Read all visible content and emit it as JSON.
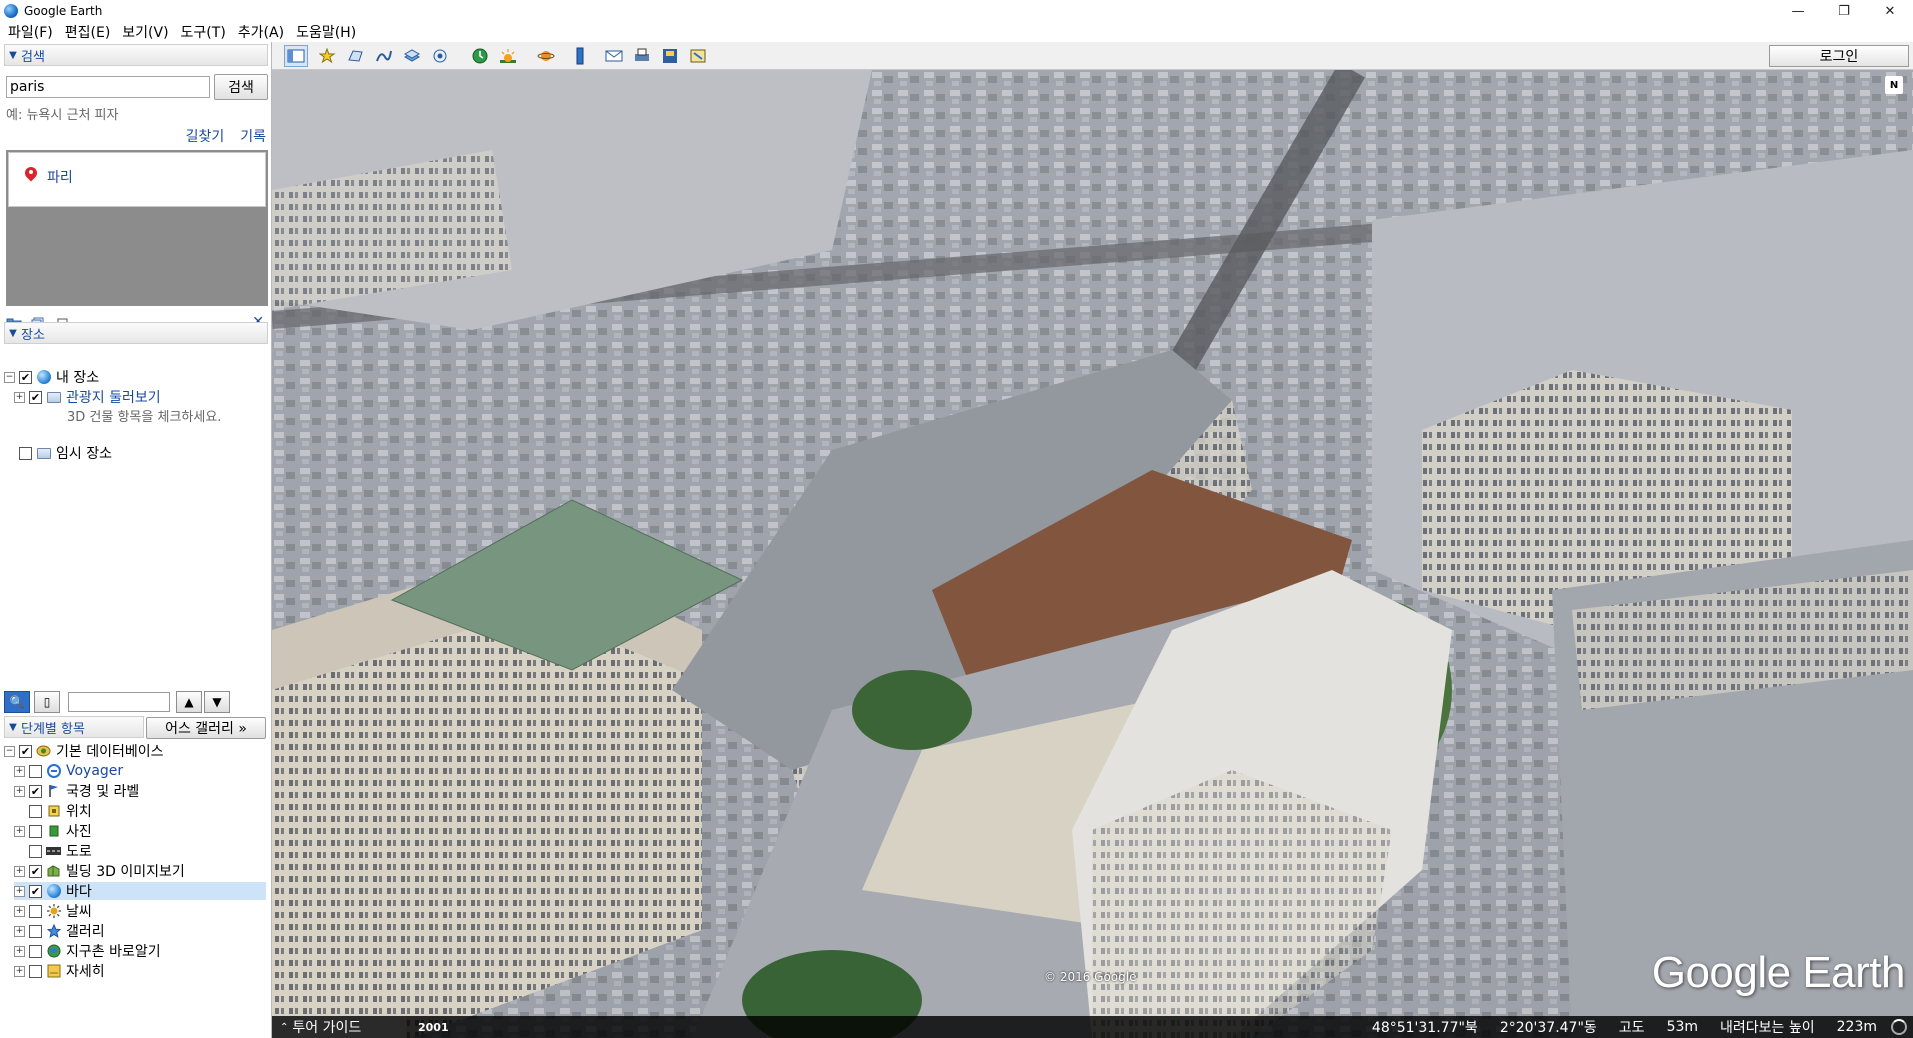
{
  "window": {
    "title": "Google Earth",
    "controls": [
      "—",
      "❐",
      "✕"
    ]
  },
  "menu": [
    "파일(F)",
    "편집(E)",
    "보기(V)",
    "도구(T)",
    "추가(A)",
    "도움말(H)"
  ],
  "search": {
    "header": "검색",
    "value": "paris",
    "button": "검색",
    "hint": "예: 뉴욕시 근처 피자",
    "links": {
      "directions": "길찾기",
      "history": "기록"
    },
    "result": "파리"
  },
  "places": {
    "header": "장소",
    "my_places": "내 장소",
    "tour": "관광지 둘러보기",
    "tour_note": "3D 건물 항목을 체크하세요.",
    "temporary": "임시 장소"
  },
  "layers": {
    "header": "단계별 항목",
    "gallery_button": "어스 갤러리 »",
    "items": [
      {
        "label": "기본 데이터베이스",
        "checked": true,
        "icon": "database-icon"
      },
      {
        "label": "Voyager",
        "checked": false,
        "icon": "voyager-icon",
        "link": true
      },
      {
        "label": "국경 및 라벨",
        "checked": true,
        "icon": "flag-icon"
      },
      {
        "label": "위치",
        "checked": false,
        "icon": "location-icon"
      },
      {
        "label": "사진",
        "checked": false,
        "icon": "photo-icon"
      },
      {
        "label": "도로",
        "checked": false,
        "icon": "road-icon"
      },
      {
        "label": "빌딩 3D 이미지보기",
        "checked": true,
        "icon": "building-3d-icon"
      },
      {
        "label": "바다",
        "checked": true,
        "icon": "ocean-icon",
        "selected": true
      },
      {
        "label": "날씨",
        "checked": false,
        "icon": "weather-icon"
      },
      {
        "label": "갤러리",
        "checked": false,
        "icon": "gallery-icon"
      },
      {
        "label": "지구촌 바로알기",
        "checked": false,
        "icon": "globe-awareness-icon"
      },
      {
        "label": "자세히",
        "checked": false,
        "icon": "more-icon"
      }
    ]
  },
  "toolbar": {
    "login": "로그인",
    "tools": [
      "sidebar-toggle-icon",
      "placemark-icon",
      "polygon-icon",
      "path-icon",
      "image-overlay-icon",
      "record-tour-icon",
      "historical-imagery-icon",
      "sunlight-icon",
      "planets-icon",
      "ruler-icon",
      "email-icon",
      "print-icon",
      "save-image-icon",
      "google-maps-icon"
    ]
  },
  "view": {
    "copyright": "© 2016 Google",
    "watermark": "Google Earth",
    "north": "N"
  },
  "status": {
    "tour_guide": "투어 가이드",
    "year": "2001",
    "lat": "48°51'31.77\"북",
    "lon": "2°20'37.47\"동",
    "elev_label": "고도",
    "elev": "53m",
    "eye_label": "내려다보는 높이",
    "eye": "223m"
  },
  "colors": {
    "accent": "#1a4a9c",
    "selection": "#cde3f7",
    "pin": "#d8262c"
  }
}
